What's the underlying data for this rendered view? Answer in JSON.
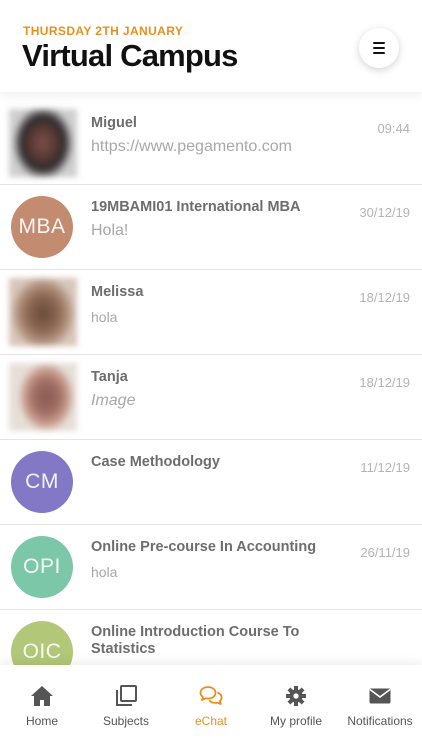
{
  "header": {
    "date": "THURSDAY 2TH JANUARY",
    "title": "Virtual Campus"
  },
  "colors": {
    "accent": "#e8901e",
    "avatar_mba": "#c38c71",
    "avatar_cm": "#8378c6",
    "avatar_opi": "#7dc7a9",
    "avatar_oic": "#b2c878"
  },
  "chats": [
    {
      "name": "Miguel",
      "message": "https://www.pegamento.com",
      "time": "09:44",
      "avatar_type": "photo"
    },
    {
      "name": "19MBAMI01 International MBA",
      "message": "Hola!",
      "time": "30/12/19",
      "initials": "MBA"
    },
    {
      "name": "Melissa",
      "message": "hola",
      "time": "18/12/19",
      "avatar_type": "photo"
    },
    {
      "name": "Tanja",
      "message": "Image",
      "time": "18/12/19",
      "avatar_type": "photo"
    },
    {
      "name": "Case Methodology",
      "message": "",
      "time": "11/12/19",
      "initials": "CM"
    },
    {
      "name": "Online Pre-course In Accounting",
      "message": "hola",
      "time": "26/11/19",
      "initials": "OPI"
    },
    {
      "name": "Online Introduction Course To Statistics",
      "message": "",
      "time": "",
      "initials": "OIC"
    }
  ],
  "tabs": [
    {
      "label": "Home",
      "icon": "home-icon"
    },
    {
      "label": "Subjects",
      "icon": "subjects-icon"
    },
    {
      "label": "eChat",
      "icon": "chat-icon",
      "active": true
    },
    {
      "label": "My profile",
      "icon": "gear-icon"
    },
    {
      "label": "Notifications",
      "icon": "envelope-icon"
    }
  ]
}
